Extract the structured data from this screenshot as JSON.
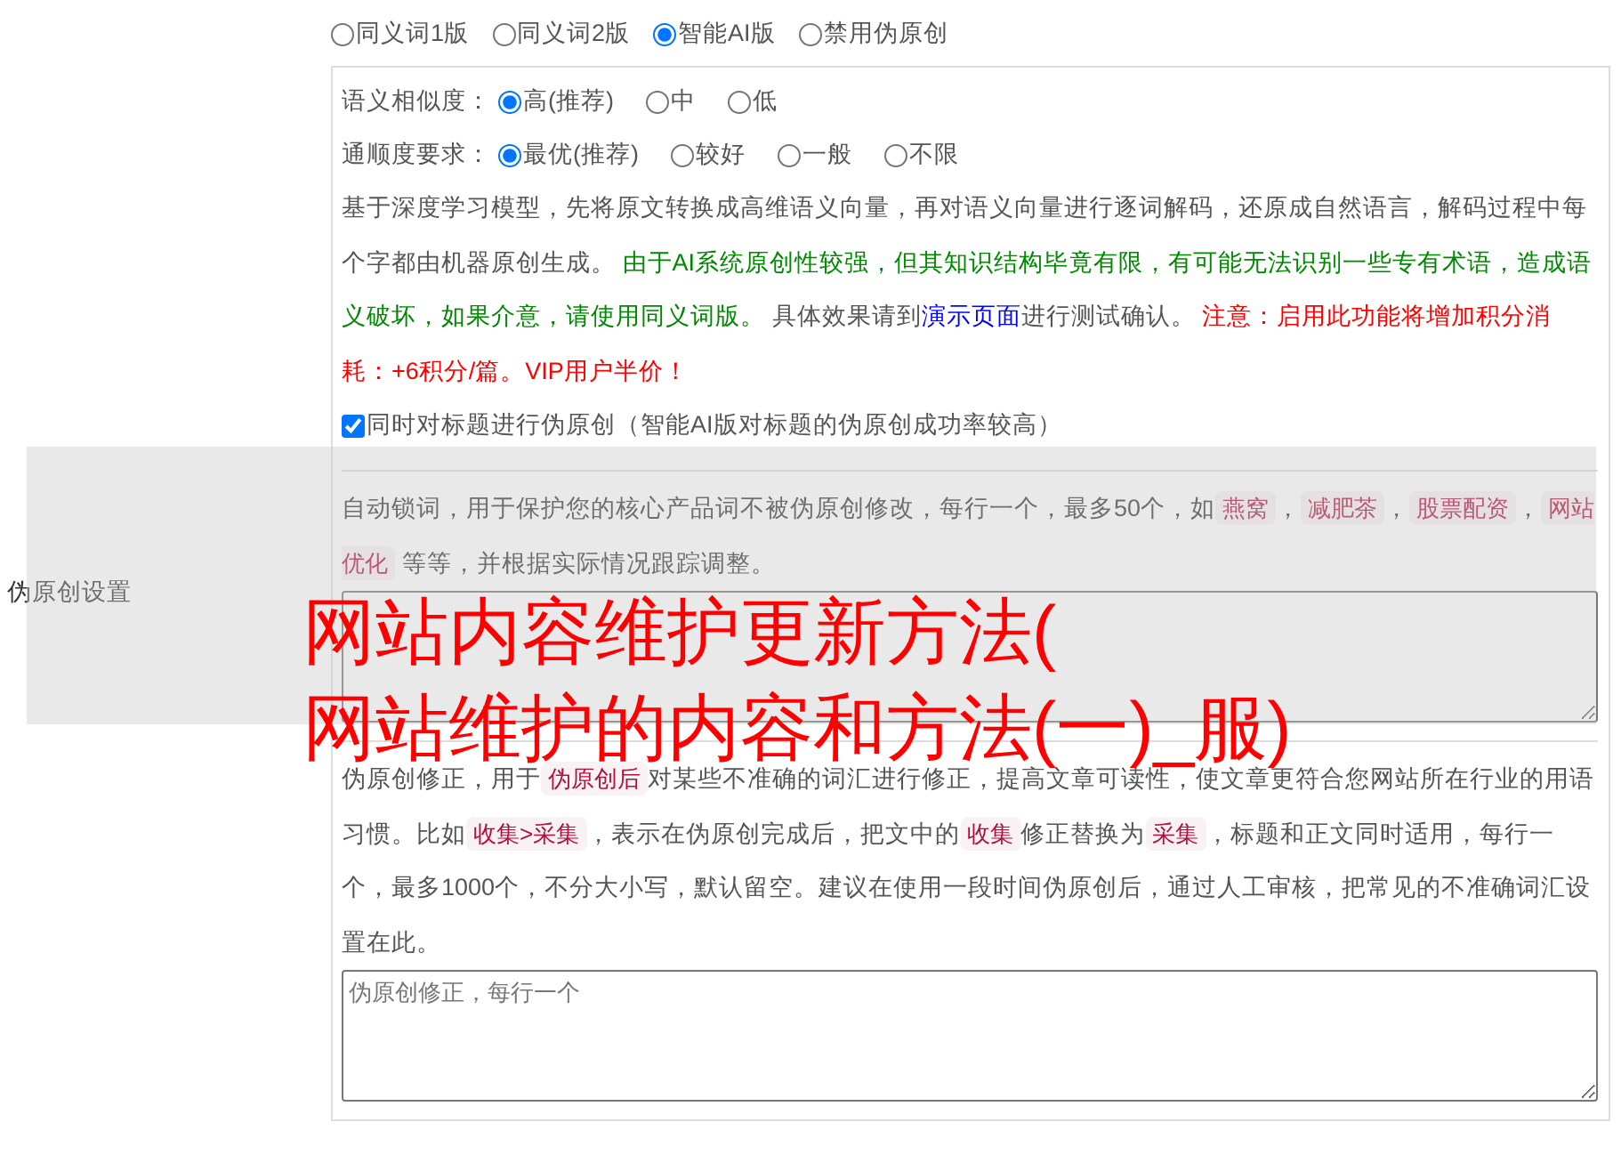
{
  "section_label": "伪原创设置",
  "modes": [
    {
      "label": "同义词1版",
      "selected": false
    },
    {
      "label": "同义词2版",
      "selected": false
    },
    {
      "label": "智能AI版",
      "selected": true
    },
    {
      "label": "禁用伪原创",
      "selected": false
    }
  ],
  "options": [
    {
      "label": "语义相似度：",
      "choices": [
        {
          "label": "高(推荐)",
          "selected": true
        },
        {
          "label": "中",
          "selected": false
        },
        {
          "label": "低",
          "selected": false
        }
      ]
    },
    {
      "label": "通顺度要求：",
      "choices": [
        {
          "label": "最优(推荐)",
          "selected": true
        },
        {
          "label": "较好",
          "selected": false
        },
        {
          "label": "一般",
          "selected": false
        },
        {
          "label": "不限",
          "selected": false
        }
      ]
    }
  ],
  "description": [
    {
      "kind": "plain",
      "text": "基于深度学习模型，先将原文转换成高维语义向量，再对语义向量进行逐词解码，还原成自然语言，解码过程中每个字都由机器原创生成。 "
    },
    {
      "kind": "notice",
      "text": "由于AI系统原创性较强，但其知识结构毕竟有限，有可能无法识别一些专有术语，造成语义破坏，如果介意，请使用同义词版。"
    },
    {
      "kind": "plain",
      "text": " 具体效果请到"
    },
    {
      "kind": "link",
      "text": "演示页面"
    },
    {
      "kind": "plain",
      "text": "进行测试确认。 "
    },
    {
      "kind": "warning",
      "text": "注意：启用此功能将增加积分消耗：+6积分/篇。VIP用户半价！"
    }
  ],
  "title_checkbox": {
    "label": "同时对标题进行伪原创（智能AI版对标题的伪原创成功率较高）",
    "checked": true
  },
  "lock_words": {
    "segments": [
      {
        "kind": "plain",
        "text": "自动锁词，用于保护您的核心产品词不被伪原创修改，每行一个，最多50个，如"
      },
      {
        "kind": "code",
        "text": "燕窝"
      },
      {
        "kind": "plain",
        "text": "，"
      },
      {
        "kind": "code",
        "text": "减肥茶"
      },
      {
        "kind": "plain",
        "text": "，"
      },
      {
        "kind": "code",
        "text": "股票配资"
      },
      {
        "kind": "plain",
        "text": "，"
      },
      {
        "kind": "code",
        "text": "网站优化"
      },
      {
        "kind": "plain",
        "text": " 等等，并根据实际情况跟踪调整。"
      }
    ]
  },
  "corrections": {
    "segments": [
      {
        "kind": "plain",
        "text": "伪原创修正，用于"
      },
      {
        "kind": "code",
        "text": "伪原创后"
      },
      {
        "kind": "plain",
        "text": "对某些不准确的词汇进行修正，提高文章可读性，使文章更符合您网站所在行业的用语习惯。比如"
      },
      {
        "kind": "code",
        "text": "收集>采集"
      },
      {
        "kind": "plain",
        "text": "，表示在伪原创完成后，把文中的"
      },
      {
        "kind": "code",
        "text": "收集"
      },
      {
        "kind": "plain",
        "text": "修正替换为"
      },
      {
        "kind": "code",
        "text": "采集"
      },
      {
        "kind": "plain",
        "text": "，标题和正文同时适用，每行一个，最多1000个，不分大小写，默认留空。建议在使用一段时间伪原创后，通过人工审核，把常见的不准确词汇设置在此。"
      }
    ],
    "placeholder": "伪原创修正，每行一个"
  },
  "overlay": {
    "lines": [
      "网站内容维护更新方法(",
      "网站维护的内容和方法(一)_服)"
    ]
  }
}
